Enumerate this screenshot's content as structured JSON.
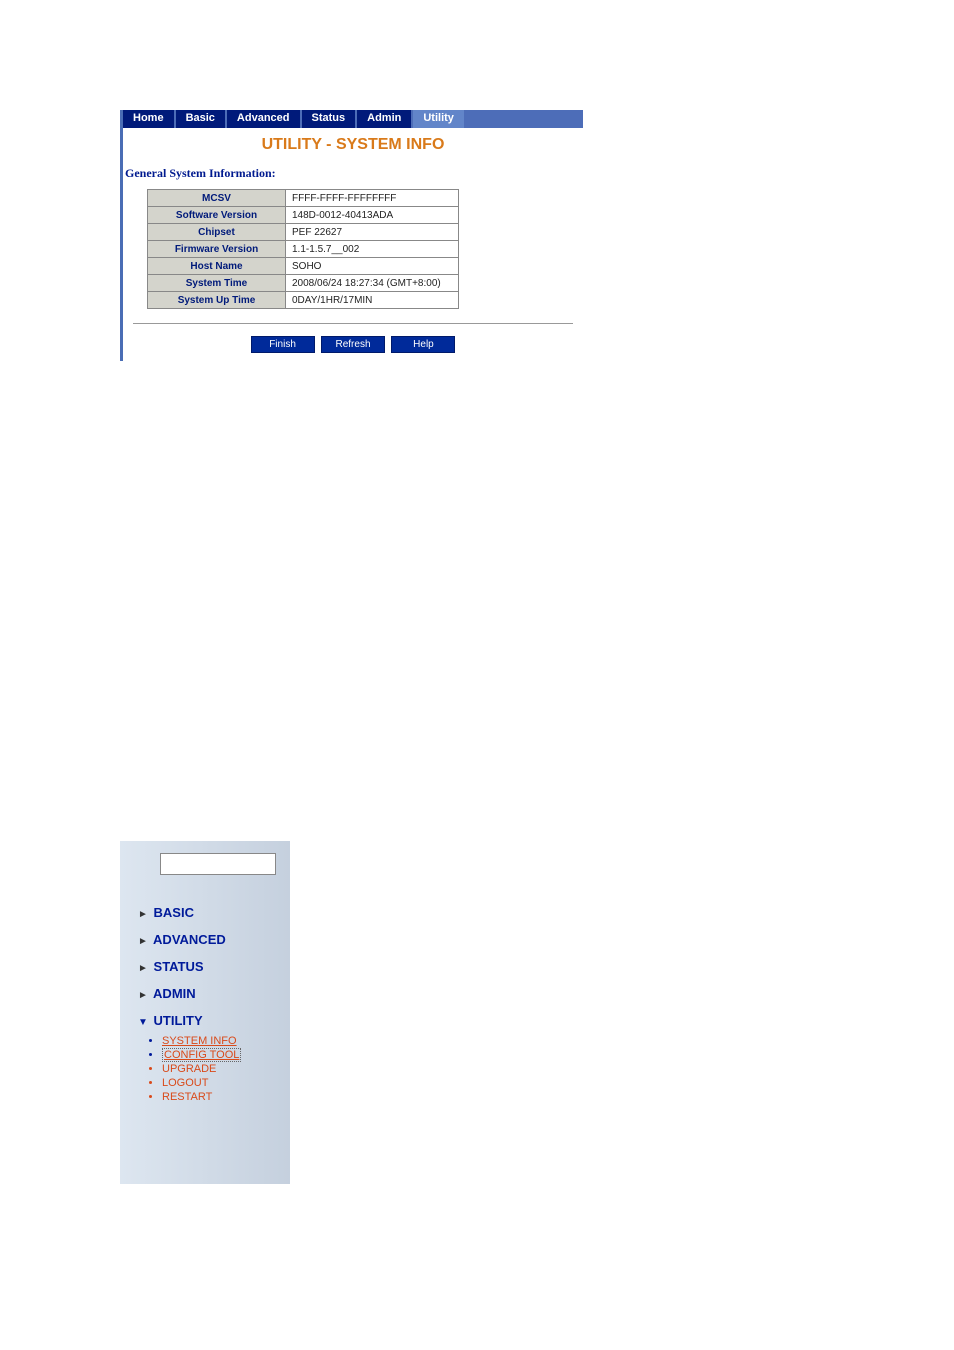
{
  "tabs": {
    "home": "Home",
    "basic": "Basic",
    "advanced": "Advanced",
    "status": "Status",
    "admin": "Admin",
    "utility": "Utility"
  },
  "title": "UTILITY - SYSTEM INFO",
  "section_title": "General System Information:",
  "info": {
    "mcsv": {
      "label": "MCSV",
      "value": "FFFF-FFFF-FFFFFFFF"
    },
    "software_version": {
      "label": "Software Version",
      "value": "148D-0012-40413ADA"
    },
    "chipset": {
      "label": "Chipset",
      "value": "PEF 22627"
    },
    "firmware_version": {
      "label": "Firmware Version",
      "value": "1.1-1.5.7__002"
    },
    "host_name": {
      "label": "Host Name",
      "value": "SOHO"
    },
    "system_time": {
      "label": "System Time",
      "value": "2008/06/24 18:27:34 (GMT+8:00)"
    },
    "system_uptime": {
      "label": "System Up Time",
      "value": "0DAY/1HR/17MIN"
    }
  },
  "buttons": {
    "finish": "Finish",
    "refresh": "Refresh",
    "help": "Help"
  },
  "sidebar": {
    "basic": "BASIC",
    "advanced": "ADVANCED",
    "status": "STATUS",
    "admin": "ADMIN",
    "utility": "UTILITY",
    "utility_items": {
      "system_info": "SYSTEM INFO",
      "config_tool": "CONFIG TOOL",
      "upgrade": "UPGRADE",
      "logout": "LOGOUT",
      "restart": "RESTART"
    }
  }
}
